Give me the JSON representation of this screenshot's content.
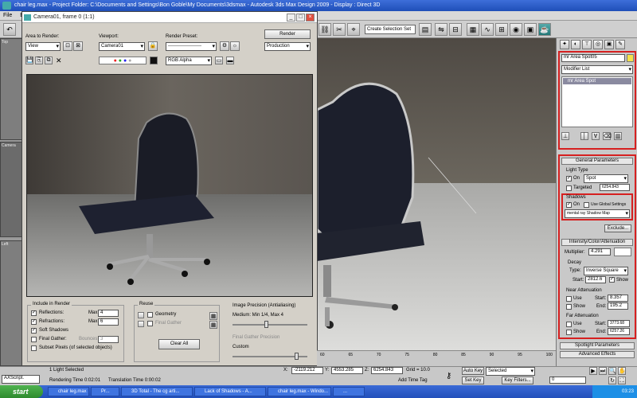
{
  "app": {
    "title": "chair leg.max    - Project Folder: C:\\Documents and Settings\\Bon Goble\\My Documents\\3dsmax    - Autodesk 3ds Max Design 2009    - Display : Direct 3D",
    "menu": [
      "File",
      "Edit"
    ]
  },
  "toolbar": {
    "selection_set": "Create Selection Set"
  },
  "left_views": [
    "Top",
    "Camera",
    "Left"
  ],
  "render_window": {
    "title": "Camera01, frame 0 (1:1)",
    "area_to_render_label": "Area to Render:",
    "area_to_render_value": "View",
    "viewport_label": "Viewport:",
    "viewport_value": "Camera01",
    "render_preset_label": "Render Preset:",
    "render_preset_value": "---------------------",
    "render_button": "Render",
    "production_value": "Production",
    "channel_value": "RGB Alpha",
    "include_in_render": {
      "title": "Include in Render",
      "reflections": "Reflections:",
      "refractions": "Refractions:",
      "soft_shadows": "Soft Shadows",
      "final_gather": "Final Gather:",
      "subset_pixels": "Subset Pixels (of selected objects)",
      "max_label": "Max:",
      "reflections_max": "4",
      "refractions_max": "6",
      "bounces_label": "Bounces:",
      "bounces_value": "3"
    },
    "reuse": {
      "title": "Reuse",
      "geometry": "Geometry",
      "final_gather": "Final Gather",
      "clear_all": "Clear All"
    },
    "image_precision": {
      "title": "Image Precision (Antialiasing)",
      "value": "Medium: Min 1/4, Max 4",
      "final_gather_precision": "Final Gather Precision",
      "custom": "Custom"
    }
  },
  "command_panel": {
    "object_name": "mr Area Spot05",
    "modifier_list": "Modifier List",
    "stack_item": "mr Area Spot",
    "general_parameters": "General Parameters",
    "light_type_label": "Light Type",
    "on_label": "On",
    "light_type_value": "Spot",
    "targeted_label": "Targeted",
    "targeted_value": "6254.843",
    "shadows_label": "Shadows",
    "shadows_on": "On",
    "use_global_settings": "Use Global Settings",
    "shadow_type": "mental ray Shadow Map",
    "exclude_button": "Exclude...",
    "intensity_rollout": "Intensity/Color/Attenuation",
    "multiplier_label": "Multiplier:",
    "multiplier_value": "4.291",
    "decay_label": "Decay",
    "decay_type_label": "Type:",
    "decay_type_value": "Inverse Square",
    "decay_start_label": "Start:",
    "decay_start_value": "2812.6",
    "show_label": "Show",
    "near_attenuation": "Near Attenuation",
    "use_label": "Use",
    "start_label": "Start:",
    "end_label": "End:",
    "near_start": "8.357",
    "near_end": "195.2",
    "far_attenuation": "Far Attenuation",
    "far_start": "3773.68",
    "far_end": "6257.26",
    "spotlight_parameters": "Spotlight Parameters",
    "advanced_effects": "Advanced Effects"
  },
  "timeline": {
    "ticks": [
      "60",
      "65",
      "70",
      "75",
      "80",
      "85",
      "90",
      "95",
      "100"
    ]
  },
  "status": {
    "script_label": "AXScript.",
    "selection": "1 Light Selected",
    "rendering_time_label": "Rendering Time  0:02:01",
    "translation_time_label": "Translation Time  0:00:02",
    "x_value": "-2119.212",
    "y_value": "4553.285",
    "z_value": "6254.843",
    "grid": "Grid = 10.0",
    "add_time_tag": "Add Time Tag",
    "auto_key": "Auto Key",
    "set_key": "Set Key",
    "selected_value": "Selected",
    "key_filters": "Key Filters...",
    "frame": "0"
  },
  "taskbar": {
    "start": "start",
    "tasks": [
      "chair leg.max ...",
      "Pr...",
      "3D Total - The cg arti...",
      "Lack of Shadows - A...",
      "chair leg.max - Windo...",
      "..."
    ],
    "clock": "03:23"
  },
  "colors": {
    "highlight_box": "#d62020",
    "title_blue": "#2a5bc8",
    "panel_gray": "#c9c9c9"
  }
}
